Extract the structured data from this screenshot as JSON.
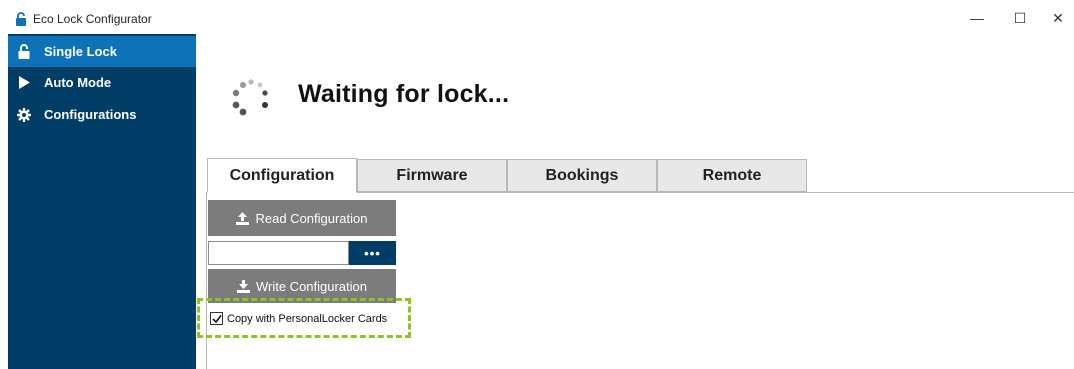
{
  "window": {
    "title": "Eco Lock Configurator",
    "controls": {
      "minimize": "—",
      "maximize": "☐",
      "close": "✕"
    }
  },
  "sidebar": {
    "items": [
      {
        "label": "Single Lock",
        "icon": "unlock-icon",
        "active": true
      },
      {
        "label": "Auto Mode",
        "icon": "play-icon",
        "active": false
      },
      {
        "label": "Configurations",
        "icon": "gear-icon",
        "active": false
      }
    ]
  },
  "main": {
    "status_text": "Waiting for lock...",
    "status_icon": "spinner-icon",
    "tabs": [
      {
        "label": "Configuration",
        "active": true
      },
      {
        "label": "Firmware",
        "active": false
      },
      {
        "label": "Bookings",
        "active": false
      },
      {
        "label": "Remote",
        "active": false
      }
    ],
    "configuration": {
      "read_button": "Read Configuration",
      "file_path": {
        "value": "",
        "placeholder": ""
      },
      "browse_button": "•••",
      "write_button": "Write Configuration",
      "copy_checkbox": {
        "label": "Copy with PersonalLocker Cards",
        "checked": true
      }
    }
  },
  "colors": {
    "sidebar_bg": "#003e68",
    "sidebar_active": "#0d72b8",
    "button_gray": "#7c7c7c",
    "highlight_dashed": "#8fc31f"
  }
}
